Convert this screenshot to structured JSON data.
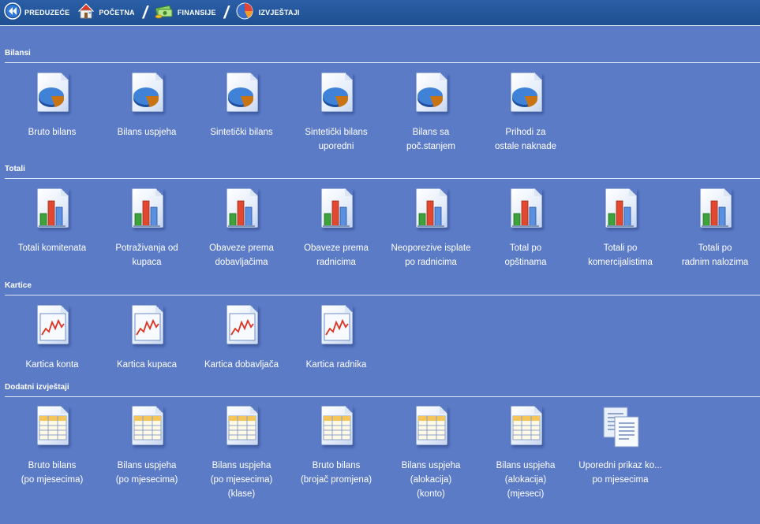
{
  "breadcrumb": [
    {
      "label": "PREDUZEĆE",
      "icon": "back-icon"
    },
    {
      "label": "POČETNA",
      "icon": "home-icon"
    },
    {
      "label": "FINANSIJE",
      "icon": "money-icon"
    },
    {
      "label": "IZVJEŠTAJI",
      "icon": "report-icon"
    }
  ],
  "separator": "/",
  "sections": [
    {
      "title": "Bilansi",
      "icon": "pie-document-icon",
      "items": [
        {
          "lines": [
            "Bruto bilans"
          ]
        },
        {
          "lines": [
            "Bilans uspjeha"
          ]
        },
        {
          "lines": [
            "Sintetički bilans"
          ]
        },
        {
          "lines": [
            "Sintetički bilans",
            "uporedni"
          ]
        },
        {
          "lines": [
            "Bilans sa",
            "poč.stanjem"
          ]
        },
        {
          "lines": [
            "Prihodi za",
            "ostale naknade"
          ]
        }
      ]
    },
    {
      "title": "Totali",
      "icon": "bar-chart-document-icon",
      "items": [
        {
          "lines": [
            "Totali komitenata"
          ]
        },
        {
          "lines": [
            "Potraživanja od",
            "kupaca"
          ]
        },
        {
          "lines": [
            "Obaveze prema",
            "dobavljačima"
          ]
        },
        {
          "lines": [
            "Obaveze prema",
            "radnicima"
          ]
        },
        {
          "lines": [
            "Neoporezive isplate",
            "po radnicima"
          ]
        },
        {
          "lines": [
            "Total po",
            "opštinama"
          ]
        },
        {
          "lines": [
            "Totali po",
            "komercijalistima"
          ]
        },
        {
          "lines": [
            "Totali po",
            "radnim nalozima"
          ]
        }
      ]
    },
    {
      "title": "Kartice",
      "icon": "line-chart-document-icon",
      "items": [
        {
          "lines": [
            "Kartica konta"
          ]
        },
        {
          "lines": [
            "Kartica kupaca"
          ]
        },
        {
          "lines": [
            "Kartica dobavljača"
          ]
        },
        {
          "lines": [
            "Kartica radnika"
          ]
        }
      ]
    },
    {
      "title": "Dodatni izvještaji",
      "icon": "table-document-icon",
      "items": [
        {
          "lines": [
            "Bruto bilans",
            "(po mjesecima)"
          ]
        },
        {
          "lines": [
            "Bilans uspjeha",
            "(po mjesecima)"
          ]
        },
        {
          "lines": [
            "Bilans uspjeha",
            "(po mjesecima)",
            "(klase)"
          ]
        },
        {
          "lines": [
            "Bruto bilans",
            "(brojač promjena)"
          ]
        },
        {
          "lines": [
            "Bilans uspjeha",
            "(alokacija)",
            "(konto)"
          ]
        },
        {
          "lines": [
            "Bilans uspjeha",
            "(alokacija)",
            "(mjeseci)"
          ]
        },
        {
          "lines": [
            "Uporedni prikaz ko...",
            "po mjesecima"
          ],
          "icon": "copy-documents-icon"
        }
      ]
    }
  ]
}
